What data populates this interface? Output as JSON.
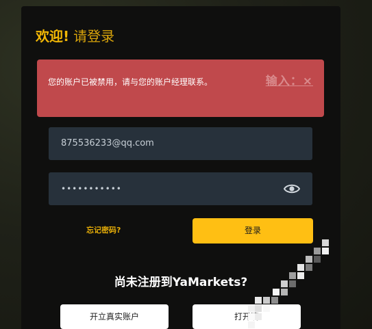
{
  "header": {
    "welcome": "欢迎!",
    "login": "请登录"
  },
  "error": {
    "message": "您的账户已被禁用，请与您的账户经理联系。",
    "close_label": "输入：×"
  },
  "form": {
    "email_value": "875536233@qq.com",
    "password_mask": "•••••••••••",
    "forgot_label": "忘记密码?",
    "login_label": "登录"
  },
  "register": {
    "title": "尚未注册到YaMarkets?",
    "real_account_label": "开立真实账户",
    "demo_account_label": "打开滴"
  },
  "colors": {
    "accent": "#ffbf13",
    "error": "#c0494c",
    "field": "#27313b"
  },
  "icons": {
    "password_toggle": "eye-icon"
  }
}
